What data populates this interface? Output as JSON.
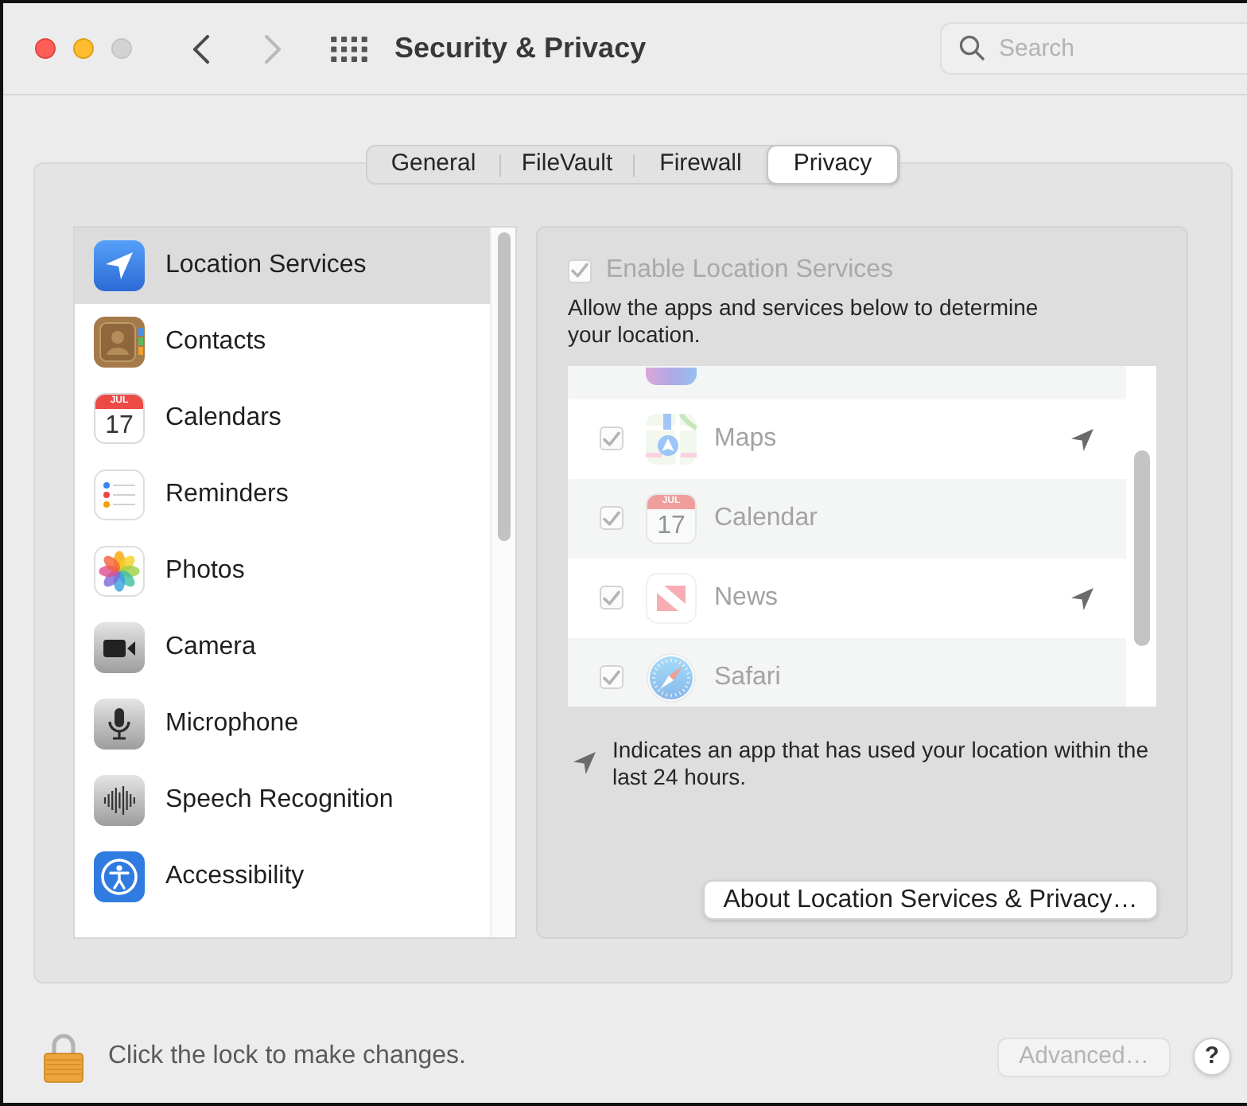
{
  "window": {
    "title": "Security & Privacy",
    "buttons": [
      {
        "kind": "close",
        "disabled": false
      },
      {
        "kind": "minimize",
        "disabled": false
      },
      {
        "kind": "zoom",
        "disabled": true
      }
    ],
    "navigation": [
      {
        "kind": "back",
        "disabled": false
      },
      {
        "kind": "forward",
        "disabled": true
      }
    ],
    "search": {
      "placeholder": "Search"
    }
  },
  "tabs": [
    {
      "label": "General",
      "selected": false
    },
    {
      "label": "FileVault",
      "selected": false
    },
    {
      "label": "Firewall",
      "selected": false
    },
    {
      "label": "Privacy",
      "selected": true
    }
  ],
  "services": [
    {
      "label": "Location Services",
      "kind": "location",
      "selected": true
    },
    {
      "label": "Contacts",
      "kind": "contacts",
      "selected": false
    },
    {
      "label": "Calendars",
      "kind": "calendar",
      "selected": false,
      "icon_text": {
        "month": "JUL",
        "day": "17"
      }
    },
    {
      "label": "Reminders",
      "kind": "reminders",
      "selected": false
    },
    {
      "label": "Photos",
      "kind": "photos",
      "selected": false
    },
    {
      "label": "Camera",
      "kind": "camera",
      "selected": false
    },
    {
      "label": "Microphone",
      "kind": "microphone",
      "selected": false
    },
    {
      "label": "Speech Recognition",
      "kind": "speech",
      "selected": false
    },
    {
      "label": "Accessibility",
      "kind": "accessibility",
      "selected": false
    }
  ],
  "location_panel": {
    "enable": {
      "label": "Enable Location Services",
      "checked": true,
      "disabled": true
    },
    "description": "Allow the apps and services below to determine your location.",
    "apps": [
      {
        "kind": "partial",
        "disabled": true
      },
      {
        "name": "Maps",
        "kind": "maps",
        "checked": true,
        "disabled": true,
        "recent": true
      },
      {
        "name": "Calendar",
        "kind": "calendar",
        "checked": true,
        "disabled": true,
        "recent": false,
        "icon_text": {
          "month": "JUL",
          "day": "17"
        }
      },
      {
        "name": "News",
        "kind": "news",
        "checked": true,
        "disabled": true,
        "recent": true
      },
      {
        "name": "Safari",
        "kind": "safari",
        "checked": true,
        "disabled": true,
        "recent": false
      }
    ],
    "legend": "Indicates an app that has used your location within the last 24 hours.",
    "about_button": "About Location Services & Privacy…"
  },
  "footer": {
    "lock": {
      "locked": true,
      "text": "Click the lock to make changes."
    },
    "advanced_button": {
      "label": "Advanced…",
      "disabled": true
    },
    "help_button": "?"
  }
}
